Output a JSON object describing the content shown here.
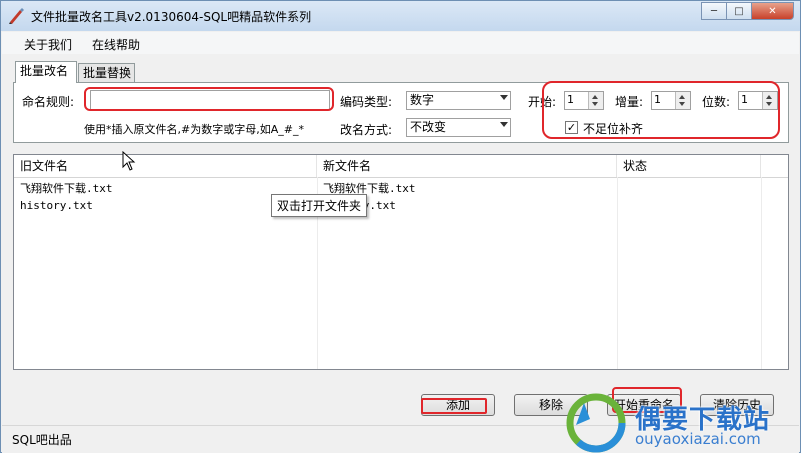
{
  "window": {
    "title": "文件批量改名工具v2.0130604-SQL吧精品软件系列",
    "controls": {
      "minimize": "─",
      "maximize": "□",
      "close": "✕"
    }
  },
  "menu": {
    "items": [
      "关于我们",
      "在线帮助"
    ]
  },
  "tabs": [
    "批量改名",
    "批量替换"
  ],
  "form": {
    "naming_rule_label": "命名规则:",
    "naming_rule_value": "",
    "encoding_label": "编码类型:",
    "encoding_value": "数字",
    "start_label": "开始:",
    "start_value": "1",
    "increment_label": "增量:",
    "increment_value": "1",
    "digits_label": "位数:",
    "digits_value": "1",
    "hint": "使用*插入原文件名,#为数字或字母,如A_#_*",
    "rename_mode_label": "改名方式:",
    "rename_mode_value": "不改变",
    "pad_label": "不足位补齐",
    "pad_checked": true
  },
  "table": {
    "columns": [
      "旧文件名",
      "新文件名",
      "状态"
    ],
    "rows": [
      {
        "old": "飞翔软件下载.txt",
        "new": "飞翔软件下载.txt",
        "status": ""
      },
      {
        "old": "history.txt",
        "new": "history.txt",
        "status": ""
      }
    ]
  },
  "tooltip": "双击打开文件夹",
  "buttons": {
    "add": "添加",
    "remove": "移除",
    "start_rename": "开始重命名",
    "clear_history": "清除历史"
  },
  "status_bar": "SQL吧出品",
  "watermark": {
    "name": "偶要下载站",
    "url": "ouyaoxiazai.com"
  },
  "colors": {
    "accent_red": "#e0262b",
    "title_bg": "#c4d8ee",
    "watermark_blue": "#2a72c9"
  }
}
